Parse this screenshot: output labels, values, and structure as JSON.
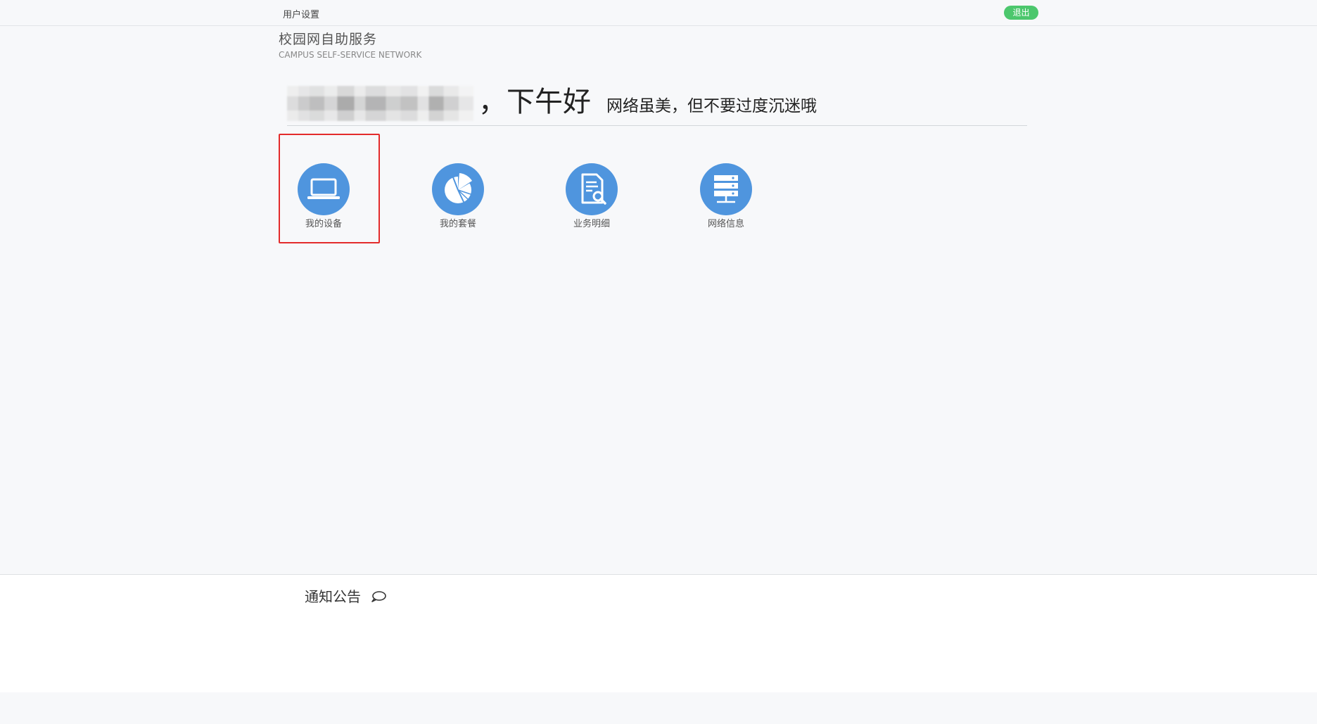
{
  "topbar": {
    "settings_label": "用户设置",
    "logout_label": "退出",
    "logout_color": "#4cc76d"
  },
  "brand": {
    "title": "校园网自助服务",
    "subtitle": "CAMPUS  SELF-SERVICE NETWORK"
  },
  "greeting": {
    "hello": "，下午好",
    "slogan": "网络虽美，但不要过度沉迷哦"
  },
  "features": [
    {
      "label": "我的设备",
      "icon": "laptop-icon",
      "selected": true
    },
    {
      "label": "我的套餐",
      "icon": "pie-chart-icon",
      "selected": false
    },
    {
      "label": "业务明细",
      "icon": "document-search-icon",
      "selected": false
    },
    {
      "label": "网络信息",
      "icon": "server-icon",
      "selected": false
    }
  ],
  "notice": {
    "title": "通知公告",
    "icon": "speech-bubble-icon"
  },
  "colors": {
    "accent_blue": "#4f95de",
    "selection_red": "#e32b2b"
  }
}
